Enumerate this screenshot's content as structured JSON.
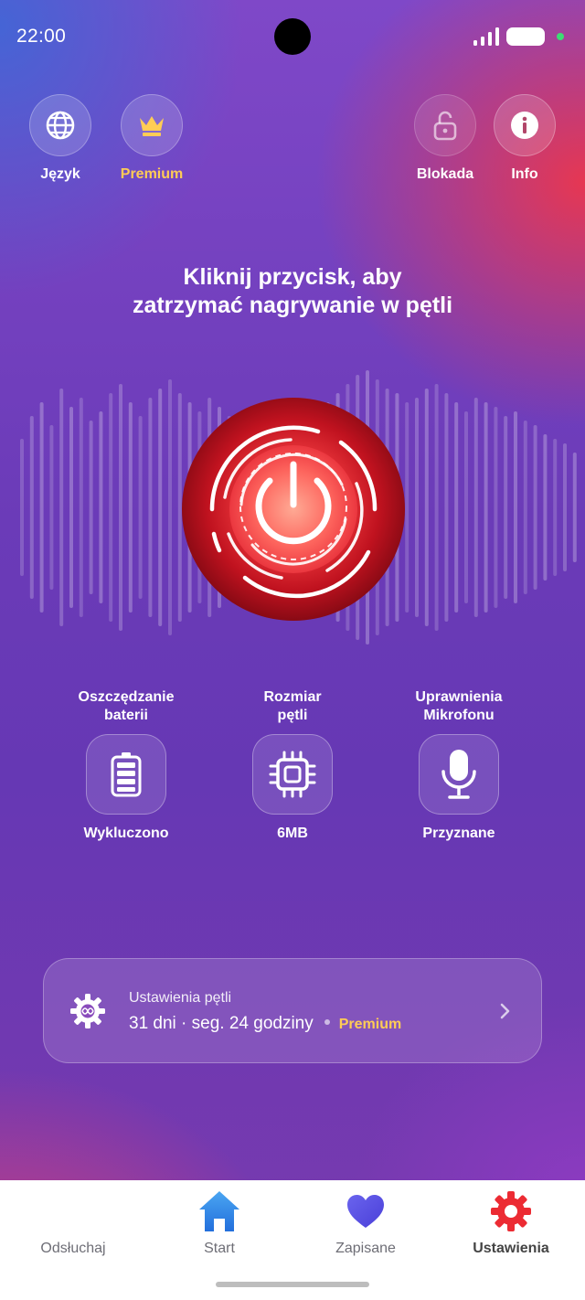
{
  "status_bar": {
    "time": "22:00"
  },
  "top_actions": {
    "language": "Język",
    "premium": "Premium",
    "lock": "Blokada",
    "info": "Info"
  },
  "prompt": {
    "line1": "Kliknij przycisk, aby",
    "line2": "zatrzymać nagrywanie w pętli"
  },
  "stats": [
    {
      "title_line1": "Oszczędzanie",
      "title_line2": "baterii",
      "value": "Wykluczono",
      "icon": "battery-icon"
    },
    {
      "title_line1": "Rozmiar",
      "title_line2": "pętli",
      "value": "6MB",
      "icon": "chip-icon"
    },
    {
      "title_line1": "Uprawnienia",
      "title_line2": "Mikrofonu",
      "value": "Przyznane",
      "icon": "microphone-icon"
    }
  ],
  "loop_settings": {
    "title": "Ustawienia pętli",
    "summary": "31 dni · seg. 24 godziny",
    "badge": "Premium"
  },
  "bottom_nav": [
    {
      "label": "Odsłuchaj",
      "icon": "waveform-icon"
    },
    {
      "label": "Start",
      "icon": "home-icon"
    },
    {
      "label": "Zapisane",
      "icon": "heart-icon"
    },
    {
      "label": "Ustawienia",
      "icon": "gear-icon",
      "active": true
    }
  ],
  "colors": {
    "premium_gold": "#ffcc55",
    "power_red": "#d8142a",
    "nav_blue": "#2f86e6",
    "nav_heart": "#5a55e8",
    "nav_gear": "#ec2b33"
  }
}
